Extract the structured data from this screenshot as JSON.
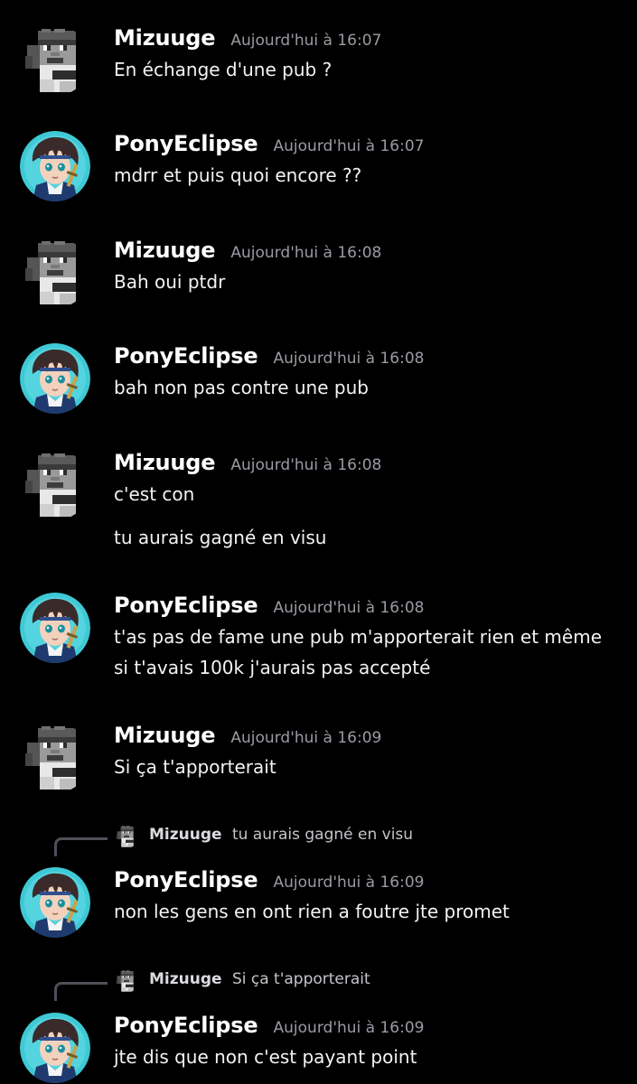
{
  "users": {
    "mizuuge": {
      "name": "Mizuuge",
      "avatar_icon": "minecraft-skin-avatar-icon"
    },
    "pony": {
      "name": "PonyEclipse",
      "avatar_icon": "anime-boy-avatar-icon",
      "avatar_bg": "#3ec9d4"
    }
  },
  "colors": {
    "background": "#000000",
    "username": "#ffffff",
    "timestamp": "#9a9ba3",
    "text": "#f2f3f5",
    "reply_line": "#4e5058"
  },
  "messages": [
    {
      "user": "Mizuuge",
      "time": "Aujourd'hui à 16:07",
      "lines": [
        "En échange d'une pub ?"
      ]
    },
    {
      "user": "PonyEclipse",
      "time": "Aujourd'hui à 16:07",
      "lines": [
        "mdrr et puis quoi encore ??"
      ]
    },
    {
      "user": "Mizuuge",
      "time": "Aujourd'hui à 16:08",
      "lines": [
        "Bah oui ptdr"
      ]
    },
    {
      "user": "PonyEclipse",
      "time": "Aujourd'hui à 16:08",
      "lines": [
        "bah non pas contre une pub"
      ]
    },
    {
      "user": "Mizuuge",
      "time": "Aujourd'hui à 16:08",
      "lines": [
        "c'est con",
        "tu aurais gagné en visu"
      ]
    },
    {
      "user": "PonyEclipse",
      "time": "Aujourd'hui à 16:08",
      "lines": [
        "t'as pas de fame une pub m'apporterait rien et même si t'avais 100k j'aurais pas accepté"
      ]
    },
    {
      "user": "Mizuuge",
      "time": "Aujourd'hui à 16:09",
      "lines": [
        "Si ça t'apporterait"
      ]
    },
    {
      "user": "PonyEclipse",
      "time": "Aujourd'hui à 16:09",
      "lines": [
        "non les gens en ont rien a foutre jte promet"
      ],
      "reply": {
        "user": "Mizuuge",
        "text": "tu aurais gagné en visu"
      }
    },
    {
      "user": "PonyEclipse",
      "time": "Aujourd'hui à 16:09",
      "lines": [
        "jte dis que non c'est payant point"
      ],
      "reply": {
        "user": "Mizuuge",
        "text": "Si ça t'apporterait"
      }
    }
  ]
}
